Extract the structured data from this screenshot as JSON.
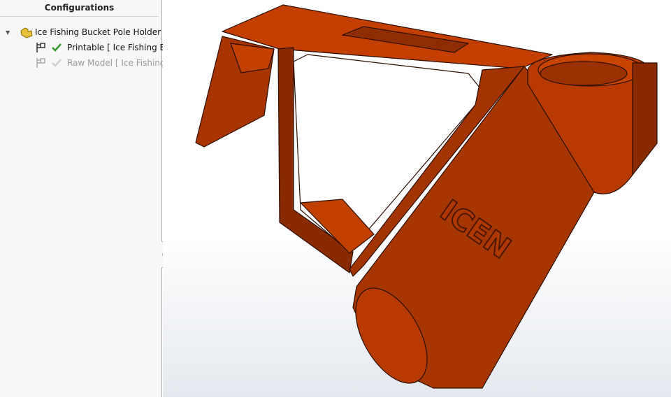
{
  "panel": {
    "title": "Configurations",
    "root": {
      "label": "Ice Fishing Bucket Pole Holder Co",
      "icon": "part-icon"
    },
    "configs": [
      {
        "label": "Printable [ Ice Fishing Bu",
        "active": true
      },
      {
        "label": "Raw Model [ Ice Fishing B",
        "active": false
      }
    ]
  },
  "model": {
    "color": "#b83a00",
    "embossed_text": "ICEN"
  }
}
